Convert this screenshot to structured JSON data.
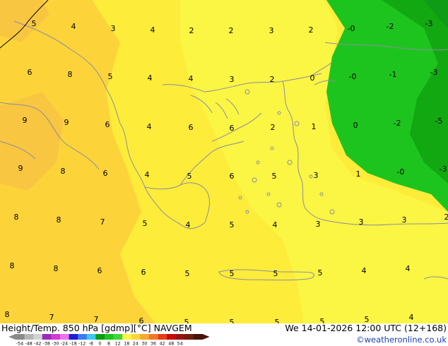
{
  "title": "Height/Temp. 850 hPa [gdmp][°C] NAVGEM",
  "datetime": "We 14-01-2026 12:00 UTC (12+168)",
  "credit": "©weatheronline.co.uk",
  "colors": {
    "yellow_light": "#fbf543",
    "yellow": "#fdec3a",
    "yellow_orange": "#fcd43a",
    "orange_light": "#f8c640",
    "green": "#1ec41e",
    "green_light": "#3fd63a",
    "green_dark": "#12a812",
    "green_darkest": "#0e9b15",
    "coast": "#8d8d9f",
    "credit_blue": "#1a3fae"
  },
  "colorbar": {
    "ticks": [
      "-54",
      "-48",
      "-42",
      "-38",
      "-30",
      "-24",
      "-18",
      "-12",
      "-8",
      "0",
      "8",
      "12",
      "18",
      "24",
      "30",
      "36",
      "42",
      "48",
      "54"
    ],
    "colors": [
      "#8a8a8a",
      "#b5b5b5",
      "#d2d2d2",
      "#9b2bb8",
      "#d23ad2",
      "#ea72ea",
      "#1e1ed2",
      "#3c7af0",
      "#3cc8f0",
      "#0e9b15",
      "#1ec41e",
      "#3fd63a",
      "#fbf543",
      "#fcd43a",
      "#f8a832",
      "#f07828",
      "#e63c14",
      "#c80a0a",
      "#961414",
      "#6e1e0a",
      "#4a1208"
    ]
  },
  "values": [
    {
      "t": "5"
    },
    {
      "t": "4"
    },
    {
      "t": "3"
    },
    {
      "t": "4"
    },
    {
      "t": "2"
    },
    {
      "t": "2"
    },
    {
      "t": "3"
    },
    {
      "t": "2"
    },
    {
      "t": "-0"
    },
    {
      "t": "-2"
    },
    {
      "t": "-3"
    },
    {
      "t": "6"
    },
    {
      "t": "8"
    },
    {
      "t": "5"
    },
    {
      "t": "4"
    },
    {
      "t": "4"
    },
    {
      "t": "3"
    },
    {
      "t": "2"
    },
    {
      "t": "0"
    },
    {
      "t": "-0"
    },
    {
      "t": "-1"
    },
    {
      "t": "-3"
    },
    {
      "t": "9"
    },
    {
      "t": "9"
    },
    {
      "t": "6"
    },
    {
      "t": "4"
    },
    {
      "t": "6"
    },
    {
      "t": "6"
    },
    {
      "t": "2"
    },
    {
      "t": "1"
    },
    {
      "t": "0"
    },
    {
      "t": "-2"
    },
    {
      "t": "-5"
    },
    {
      "t": "9"
    },
    {
      "t": "8"
    },
    {
      "t": "6"
    },
    {
      "t": "4"
    },
    {
      "t": "5"
    },
    {
      "t": "6"
    },
    {
      "t": "5"
    },
    {
      "t": "3"
    },
    {
      "t": "1"
    },
    {
      "t": "-0"
    },
    {
      "t": "-3"
    },
    {
      "t": "8"
    },
    {
      "t": "8"
    },
    {
      "t": "7"
    },
    {
      "t": "5"
    },
    {
      "t": "4"
    },
    {
      "t": "5"
    },
    {
      "t": "4"
    },
    {
      "t": "3"
    },
    {
      "t": "3"
    },
    {
      "t": "3"
    },
    {
      "t": "2"
    },
    {
      "t": "8"
    },
    {
      "t": "8"
    },
    {
      "t": "6"
    },
    {
      "t": "6"
    },
    {
      "t": "5"
    },
    {
      "t": "5"
    },
    {
      "t": "5"
    },
    {
      "t": "5"
    },
    {
      "t": "4"
    },
    {
      "t": "4"
    },
    {
      "t": "8"
    },
    {
      "t": "7"
    },
    {
      "t": "7"
    },
    {
      "t": "6"
    },
    {
      "t": "5"
    },
    {
      "t": "5"
    },
    {
      "t": "5"
    },
    {
      "t": "5"
    },
    {
      "t": "5"
    },
    {
      "t": "4"
    }
  ]
}
